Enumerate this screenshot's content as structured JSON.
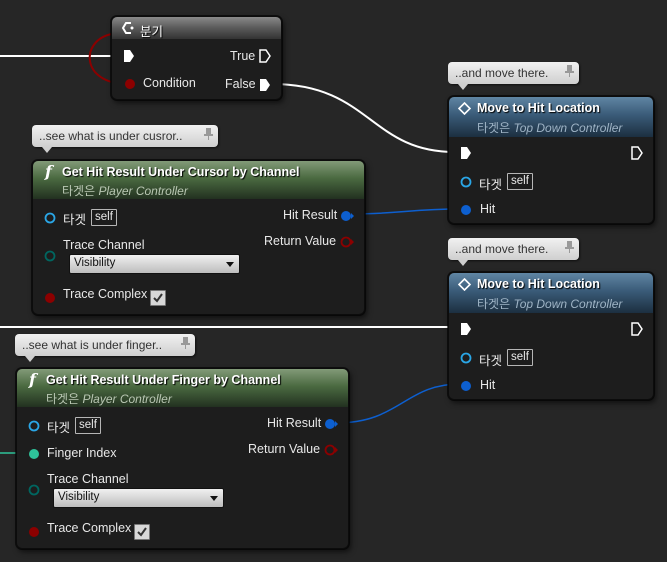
{
  "branch_node": {
    "title": "분기",
    "pins": {
      "true_label": "True",
      "condition_label": "Condition",
      "false_label": "False"
    }
  },
  "comments": [
    {
      "text": "..and move there."
    },
    {
      "text": "..see what is under cusror.."
    },
    {
      "text": "..and move there."
    },
    {
      "text": "..see what is under finger.."
    }
  ],
  "cursor_node": {
    "title": "Get Hit Result Under Cursor by Channel",
    "subtitle_prefix": "타겟은",
    "subtitle_class": "Player Controller",
    "target_label": "타겟",
    "self_label": "self",
    "hit_result_label": "Hit Result",
    "trace_channel_label": "Trace Channel",
    "return_value_label": "Return Value",
    "trace_channel_value": "Visibility",
    "trace_complex_label": "Trace Complex",
    "trace_complex_checked": true
  },
  "finger_node": {
    "title": "Get Hit Result Under Finger by Channel",
    "subtitle_prefix": "타겟은",
    "subtitle_class": "Player Controller",
    "target_label": "타겟",
    "self_label": "self",
    "hit_result_label": "Hit Result",
    "finger_index_label": "Finger Index",
    "return_value_label": "Return Value",
    "trace_channel_label": "Trace Channel",
    "trace_channel_value": "Visibility",
    "trace_complex_label": "Trace Complex",
    "trace_complex_checked": true
  },
  "move_node_1": {
    "title": "Move to Hit Location",
    "subtitle_prefix": "타겟은",
    "subtitle_class": "Top Down Controller",
    "target_label": "타겟",
    "self_label": "self",
    "hit_label": "Hit"
  },
  "move_node_2": {
    "title": "Move to Hit Location",
    "subtitle_prefix": "타겟은",
    "subtitle_class": "Top Down Controller",
    "target_label": "타겟",
    "self_label": "self",
    "hit_label": "Hit"
  },
  "colors": {
    "exec_wire": "#ffffff",
    "struct_pin": "#0d5fcf",
    "object_pin": "#2aa6e6",
    "bool_pin": "#8c0000",
    "int_pin": "#2ec39a",
    "byte_pin": "#006660",
    "graph_bg": "#262626"
  },
  "icons": {
    "function": "function-icon",
    "event": "event-icon",
    "branch": "branch-icon",
    "comment_pin": "pin-icon"
  }
}
